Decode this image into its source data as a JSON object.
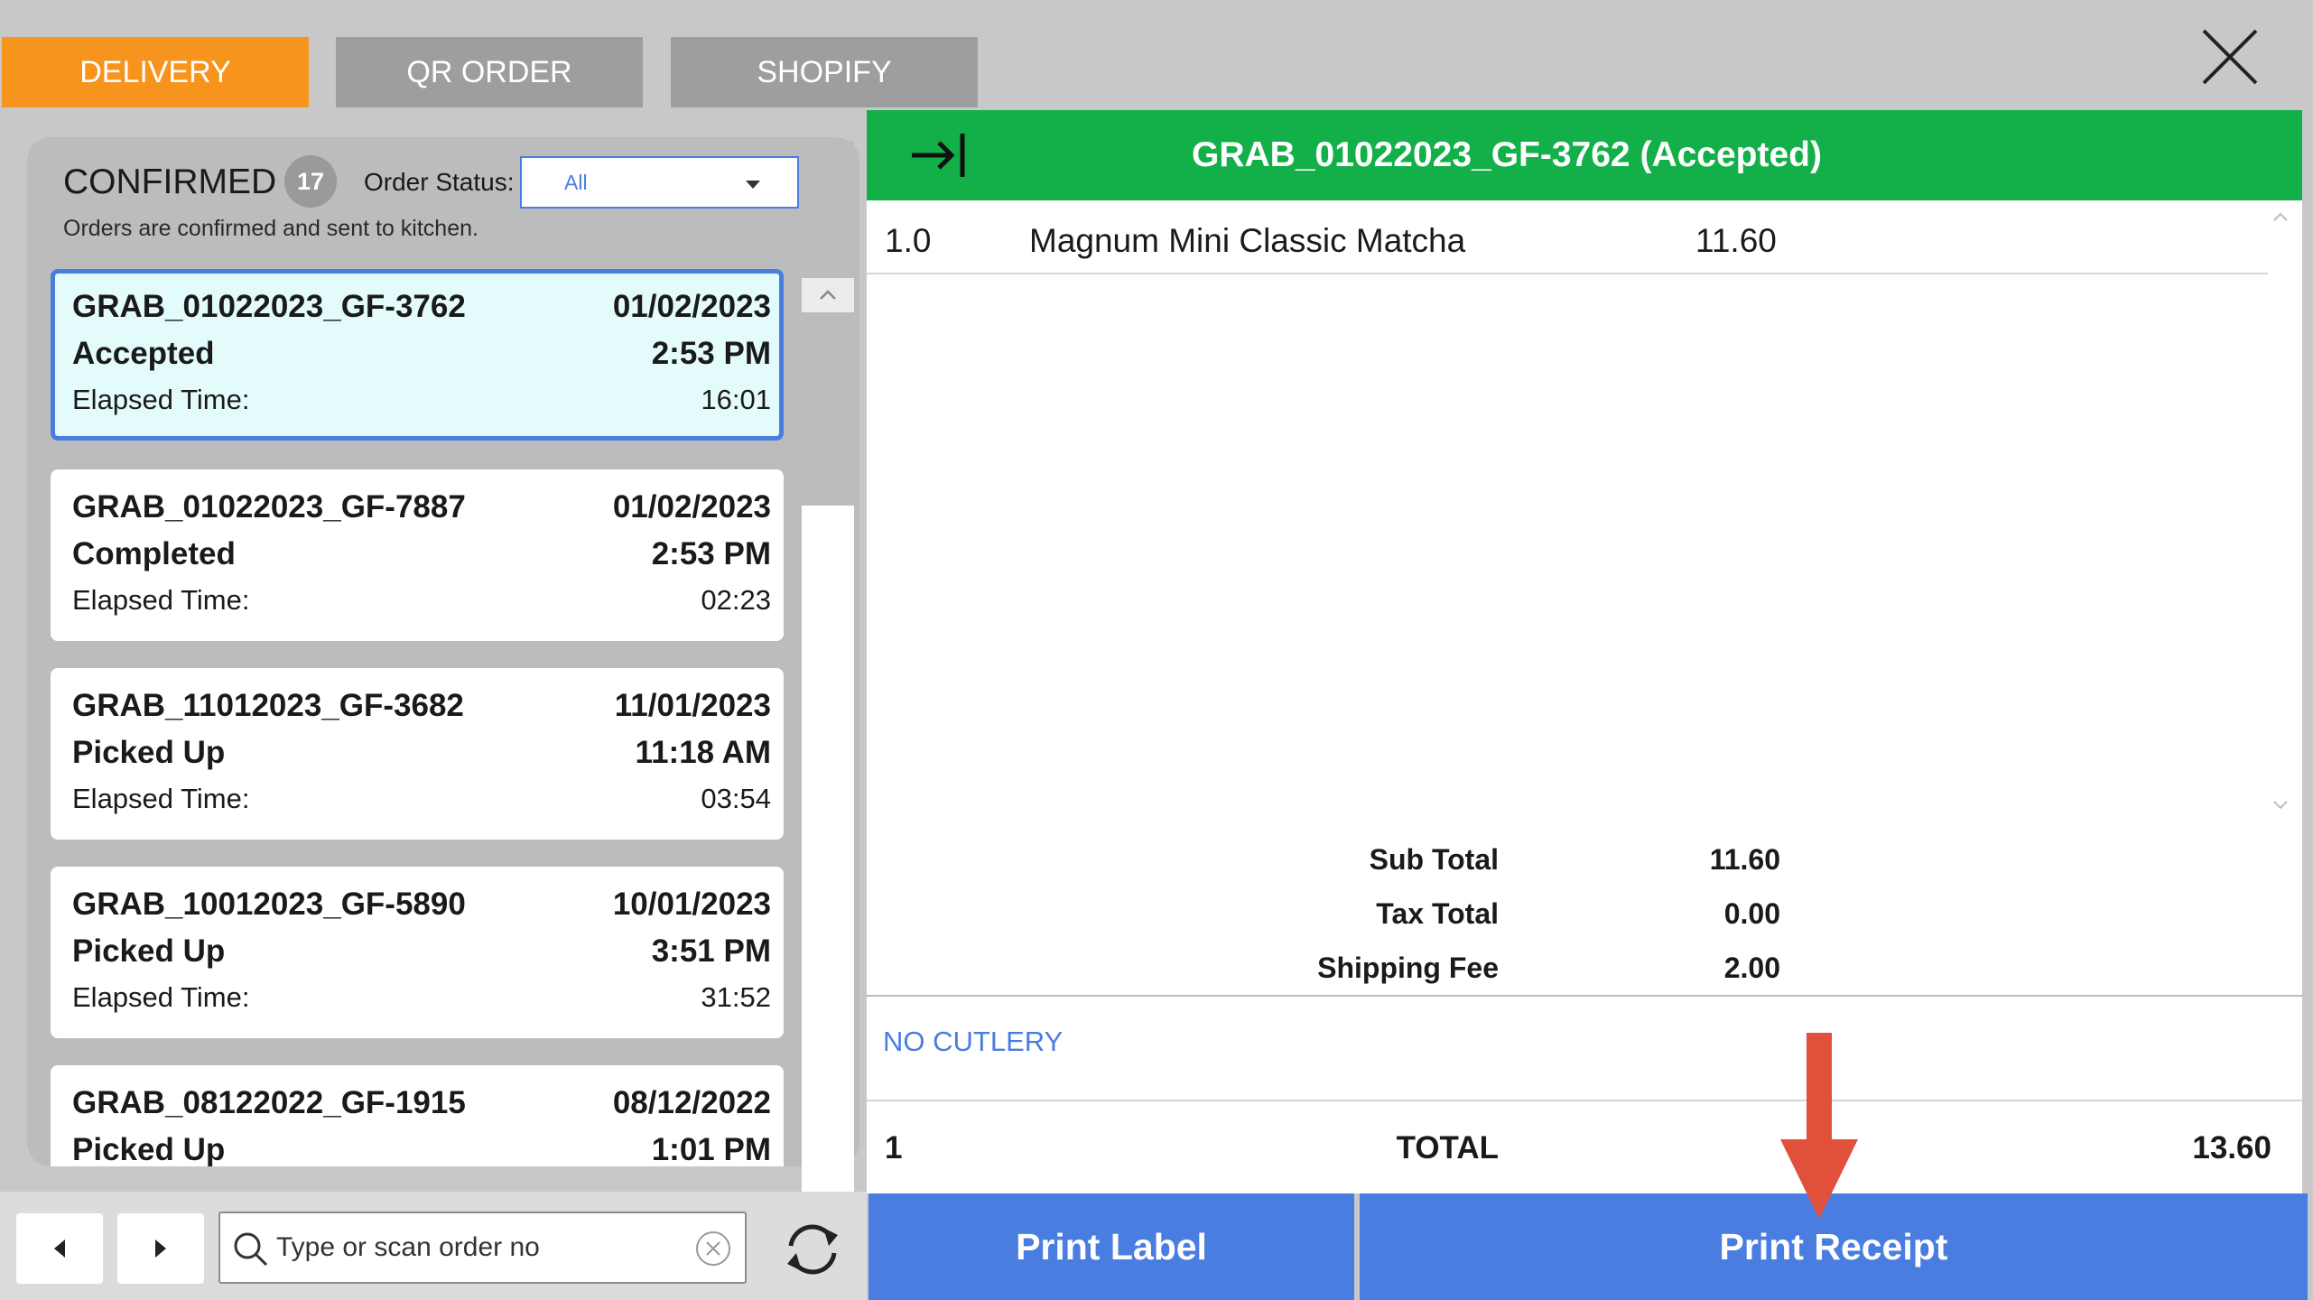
{
  "tabs": [
    {
      "label": "DELIVERY",
      "active": true
    },
    {
      "label": "QR ORDER",
      "active": false
    },
    {
      "label": "SHOPIFY",
      "active": false
    }
  ],
  "left_panel": {
    "title": "CONFIRMED",
    "count": "17",
    "status_label": "Order Status:",
    "status_value": "All",
    "subtitle": "Orders are confirmed and sent to kitchen."
  },
  "orders": [
    {
      "id": "GRAB_01022023_GF-3762",
      "date": "01/02/2023",
      "status": "Accepted",
      "time": "2:53 PM",
      "elapsed_label": "Elapsed Time:",
      "elapsed": "16:01",
      "selected": true
    },
    {
      "id": "GRAB_01022023_GF-7887",
      "date": "01/02/2023",
      "status": "Completed",
      "time": "2:53 PM",
      "elapsed_label": "Elapsed Time:",
      "elapsed": "02:23",
      "selected": false
    },
    {
      "id": "GRAB_11012023_GF-3682",
      "date": "11/01/2023",
      "status": "Picked Up",
      "time": "11:18 AM",
      "elapsed_label": "Elapsed Time:",
      "elapsed": "03:54",
      "selected": false
    },
    {
      "id": "GRAB_10012023_GF-5890",
      "date": "10/01/2023",
      "status": "Picked Up",
      "time": "3:51 PM",
      "elapsed_label": "Elapsed Time:",
      "elapsed": "31:52",
      "selected": false
    },
    {
      "id": "GRAB_08122022_GF-1915",
      "date": "08/12/2022",
      "status": "Picked Up",
      "time": "1:01 PM",
      "elapsed_label": "",
      "elapsed": "",
      "selected": false
    }
  ],
  "search": {
    "placeholder": "Type or scan order no",
    "value": ""
  },
  "detail": {
    "title": "GRAB_01022023_GF-3762 (Accepted)",
    "items": [
      {
        "qty": "1.0",
        "name": "Magnum Mini Classic Matcha",
        "price": "11.60"
      }
    ],
    "summary": [
      {
        "label": "Sub Total",
        "value": "11.60"
      },
      {
        "label": "Tax Total",
        "value": "0.00"
      },
      {
        "label": "Shipping Fee",
        "value": "2.00"
      }
    ],
    "note": "NO CUTLERY",
    "total_qty": "1",
    "total_label": "TOTAL",
    "total_value": "13.60"
  },
  "buttons": {
    "print_label": "Print Label",
    "print_receipt": "Print Receipt"
  },
  "colors": {
    "active_tab": "#f7941d",
    "inactive_tab": "#9e9e9e",
    "header_green": "#13b04a",
    "button_blue": "#4a7de0",
    "selected_card": "#e3fcfb",
    "annotation_arrow": "#e0503a"
  },
  "icons": [
    "close-icon",
    "collapse-arrow-icon",
    "search-icon",
    "clear-icon",
    "refresh-icon",
    "prev-icon",
    "next-icon",
    "chevron-up-icon",
    "chevron-down-icon",
    "dropdown-caret-icon"
  ]
}
